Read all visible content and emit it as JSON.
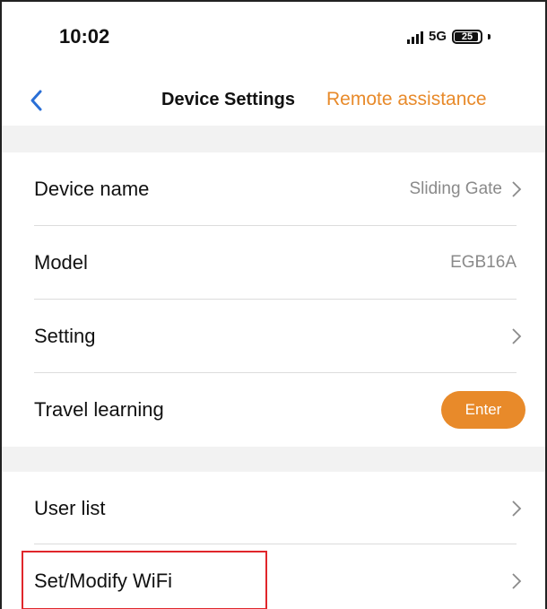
{
  "status_bar": {
    "time": "10:02",
    "network": "5G",
    "battery": "25"
  },
  "nav": {
    "back_icon": "chevron-left-icon",
    "title": "Device Settings",
    "action_label": "Remote assistance"
  },
  "settings": {
    "device_name": {
      "label": "Device name",
      "value": "Sliding Gate"
    },
    "model": {
      "label": "Model",
      "value": "EGB16A"
    },
    "setting": {
      "label": "Setting"
    },
    "travel_learning": {
      "label": "Travel learning",
      "button": "Enter"
    },
    "user_list": {
      "label": "User list"
    },
    "wifi": {
      "label": "Set/Modify WiFi"
    }
  },
  "colors": {
    "accent": "#e88a2a",
    "highlight": "#e0262b",
    "section_gap": "#f2f2f2"
  }
}
